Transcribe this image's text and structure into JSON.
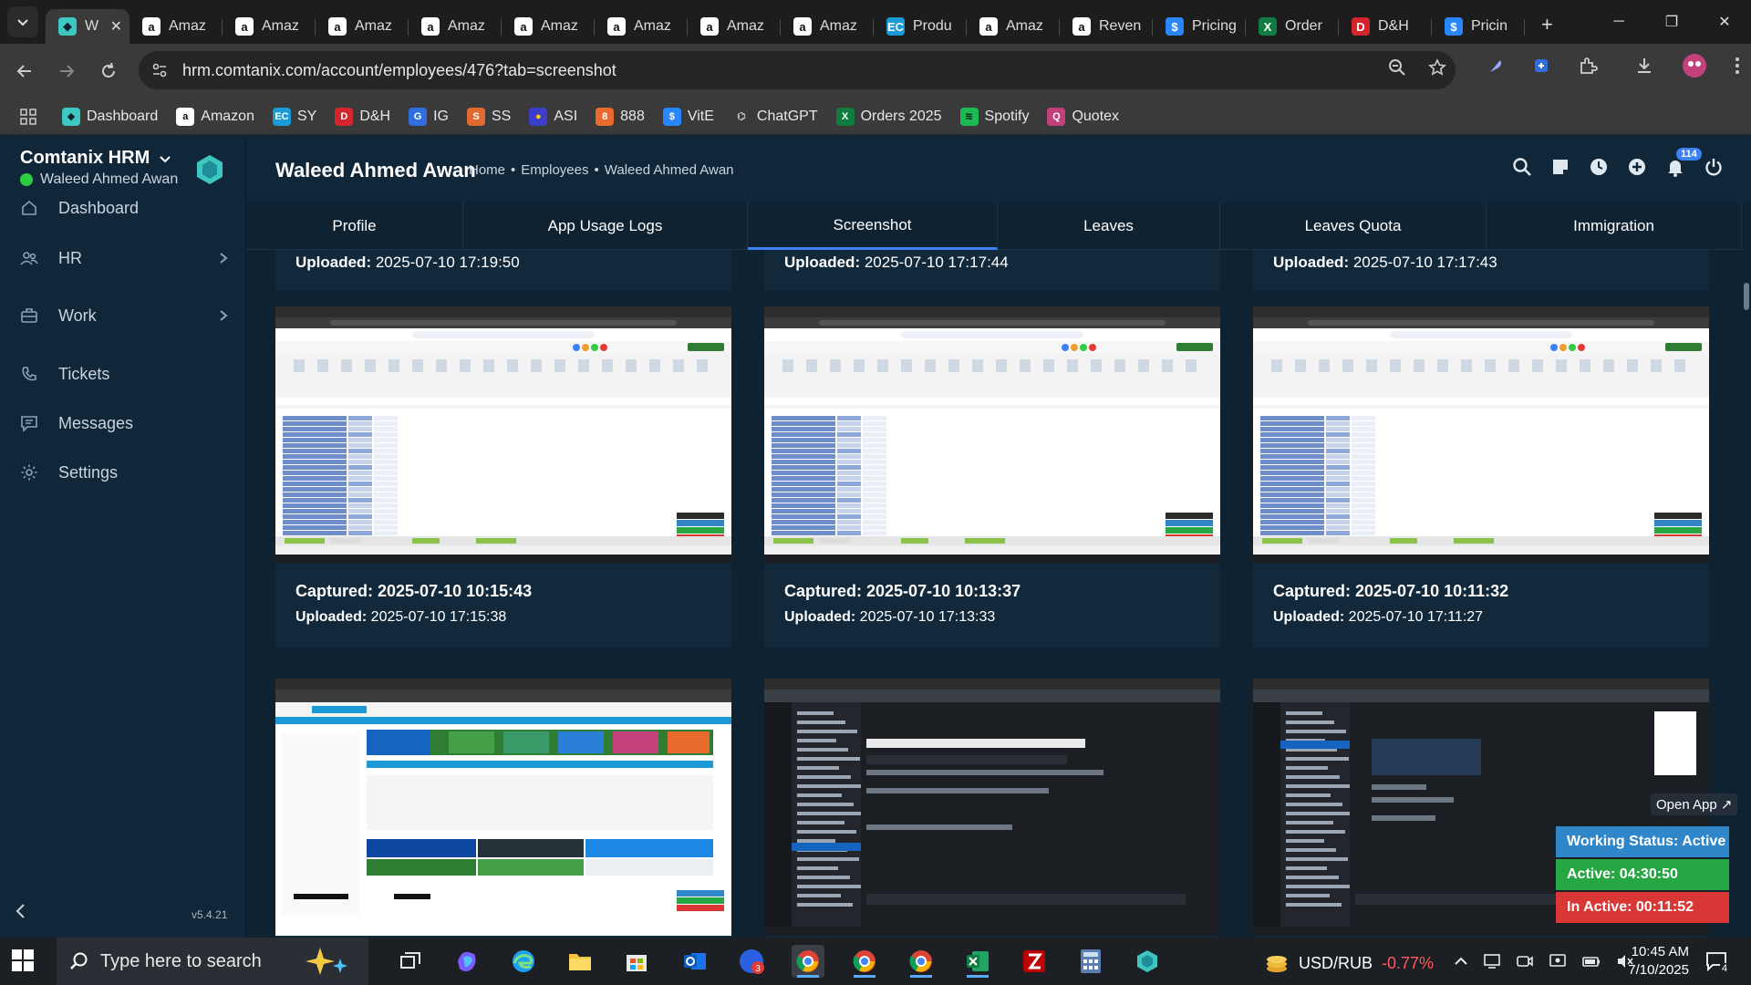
{
  "browser": {
    "tabs": [
      {
        "title": "W",
        "favicon": "comtanix-icon",
        "active": true
      },
      {
        "title": "Amaz",
        "favicon": "amazon-icon"
      },
      {
        "title": "Amaz",
        "favicon": "amazon-icon"
      },
      {
        "title": "Amaz",
        "favicon": "amazon-icon"
      },
      {
        "title": "Amaz",
        "favicon": "amazon-icon"
      },
      {
        "title": "Amaz",
        "favicon": "amazon-icon"
      },
      {
        "title": "Amaz",
        "favicon": "amazon-icon"
      },
      {
        "title": "Amaz",
        "favicon": "amazon-icon"
      },
      {
        "title": "Amaz",
        "favicon": "amazon-icon"
      },
      {
        "title": "Produ",
        "favicon": "ec-icon"
      },
      {
        "title": "Amaz",
        "favicon": "amazon-icon"
      },
      {
        "title": "Reven",
        "favicon": "amazon-icon"
      },
      {
        "title": "Pricing",
        "favicon": "dollar-icon"
      },
      {
        "title": "Order",
        "favicon": "excel-icon"
      },
      {
        "title": "D&H",
        "favicon": "dh-icon"
      },
      {
        "title": "Pricin",
        "favicon": "dollar-icon"
      }
    ],
    "url": "hrm.comtanix.com/account/employees/476?tab=screenshot",
    "bookmarks": [
      {
        "label": "Dashboard",
        "favicon": "comtanix-icon"
      },
      {
        "label": "Amazon",
        "favicon": "amazon-icon"
      },
      {
        "label": "SY",
        "favicon": "ec-icon"
      },
      {
        "label": "D&H",
        "favicon": "dh-icon"
      },
      {
        "label": "IG",
        "favicon": "ig-icon"
      },
      {
        "label": "SS",
        "favicon": "ss-icon"
      },
      {
        "label": "ASI",
        "favicon": "asi-icon"
      },
      {
        "label": "888",
        "favicon": "888-icon"
      },
      {
        "label": "VitE",
        "favicon": "dollar-icon"
      },
      {
        "label": "ChatGPT",
        "favicon": "chatgpt-icon"
      },
      {
        "label": "Orders 2025",
        "favicon": "excel-icon"
      },
      {
        "label": "Spotify",
        "favicon": "spotify-icon"
      },
      {
        "label": "Quotex",
        "favicon": "quotex-icon"
      }
    ]
  },
  "sidebar": {
    "brand": "Comtanix HRM",
    "user": "Waleed Ahmed Awan",
    "items": [
      {
        "label": "Dashboard",
        "icon": "home-icon",
        "has_children": false
      },
      {
        "label": "HR",
        "icon": "users-icon",
        "has_children": true
      },
      {
        "label": "Work",
        "icon": "briefcase-icon",
        "has_children": true
      },
      {
        "label": "Tickets",
        "icon": "phone-icon",
        "has_children": false
      },
      {
        "label": "Messages",
        "icon": "message-icon",
        "has_children": false
      },
      {
        "label": "Settings",
        "icon": "gear-icon",
        "has_children": false
      }
    ],
    "version": "v5.4.21"
  },
  "header": {
    "title": "Waleed Ahmed Awan",
    "breadcrumb": [
      "Home",
      "Employees",
      "Waleed Ahmed Awan"
    ],
    "notification_count": "114"
  },
  "tabs": [
    {
      "label": "Profile",
      "active": false
    },
    {
      "label": "App Usage Logs",
      "active": false
    },
    {
      "label": "Screenshot",
      "active": true
    },
    {
      "label": "Leaves",
      "active": false
    },
    {
      "label": "Leaves Quota",
      "active": false
    },
    {
      "label": "Immigration",
      "active": false
    }
  ],
  "screenshots": {
    "top_row": [
      {
        "uploaded_label": "Uploaded:",
        "uploaded": "2025-07-10 17:19:50"
      },
      {
        "uploaded_label": "Uploaded:",
        "uploaded": "2025-07-10 17:17:44"
      },
      {
        "uploaded_label": "Uploaded:",
        "uploaded": "2025-07-10 17:17:43"
      }
    ],
    "middle_row": [
      {
        "captured_label": "Captured:",
        "captured": "2025-07-10 10:15:43",
        "uploaded_label": "Uploaded:",
        "uploaded": "2025-07-10 17:15:38",
        "kind": "spreadsheet"
      },
      {
        "captured_label": "Captured:",
        "captured": "2025-07-10 10:13:37",
        "uploaded_label": "Uploaded:",
        "uploaded": "2025-07-10 17:13:33",
        "kind": "spreadsheet"
      },
      {
        "captured_label": "Captured:",
        "captured": "2025-07-10 10:11:32",
        "uploaded_label": "Uploaded:",
        "uploaded": "2025-07-10 17:11:27",
        "kind": "spreadsheet"
      }
    ],
    "bottom_row": [
      {
        "kind": "website"
      },
      {
        "kind": "chat"
      },
      {
        "kind": "chat"
      }
    ]
  },
  "widget": {
    "open_app": "Open App ↗",
    "working_status": "Working Status: Active",
    "active_time": "Active: 04:30:50",
    "inactive_time": "In Active: 00:11:52"
  },
  "taskbar": {
    "search_placeholder": "Type here to search",
    "ticker_pair": "USD/RUB",
    "ticker_change": "-0.77%",
    "time": "10:45 AM",
    "date": "7/10/2025",
    "notification_count": "4"
  },
  "colors": {
    "accent": "#3b82f6",
    "status_active": "#2ecc40",
    "widget_blue": "#2f86c8",
    "widget_green": "#27a744",
    "widget_red": "#d93636",
    "ticker_negative": "#ff5a5a"
  }
}
